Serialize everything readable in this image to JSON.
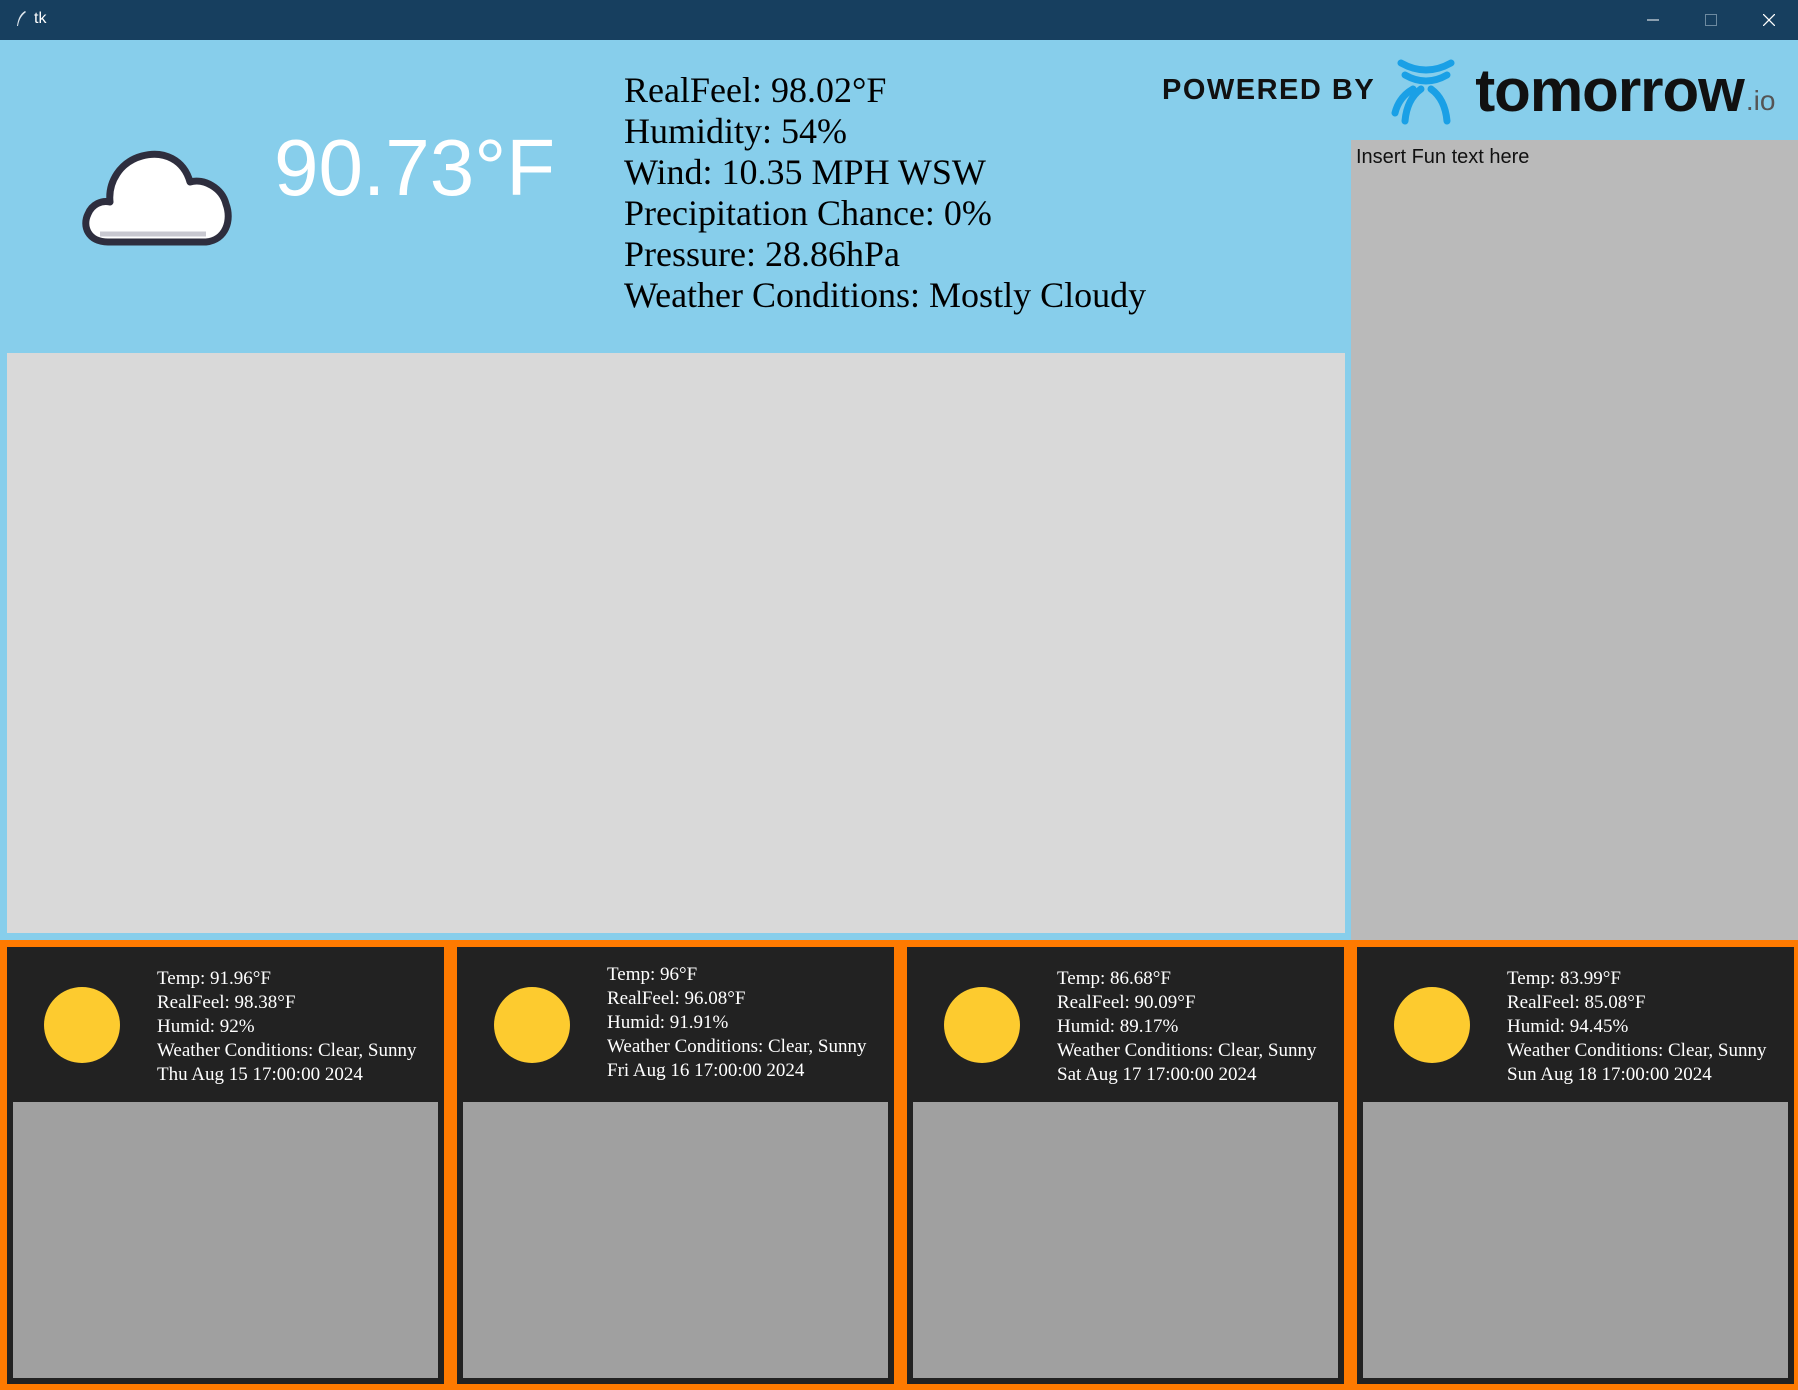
{
  "window": {
    "title": "tk",
    "icons": {
      "app": "feather-icon",
      "minimize": "minimize-icon",
      "maximize": "maximize-icon",
      "close": "close-icon"
    }
  },
  "current": {
    "temperature": "90.73°F",
    "icon": "cloud-icon",
    "details": [
      "RealFeel: 98.02°F",
      "Humidity: 54%",
      "Wind: 10.35 MPH WSW",
      "Precipitation Chance: 0%",
      "Pressure: 28.86hPa",
      "Weather Conditions: Mostly Cloudy"
    ]
  },
  "branding": {
    "powered_by": "POWERED BY",
    "name": "tomorrow",
    "suffix": ".io",
    "logo_icon": "tomorrow-io-logo-icon",
    "logo_color": "#1aa0e6"
  },
  "fun_panel": {
    "text": "Insert Fun text here"
  },
  "forecast": [
    {
      "icon": "sun-icon",
      "lines": [
        "Temp: 91.96°F",
        "RealFeel: 98.38°F",
        "Humid: 92%",
        "Weather Conditions: Clear, Sunny",
        "Thu Aug 15 17:00:00 2024"
      ]
    },
    {
      "icon": "sun-icon",
      "lines": [
        "Temp: 96°F",
        "RealFeel: 96.08°F",
        "Humid: 91.91%",
        "Weather Conditions: Clear, Sunny",
        "Fri Aug 16 17:00:00 2024"
      ]
    },
    {
      "icon": "sun-icon",
      "lines": [
        "Temp: 86.68°F",
        "RealFeel: 90.09°F",
        "Humid: 89.17%",
        "Weather Conditions: Clear, Sunny",
        "Sat Aug 17 17:00:00 2024"
      ]
    },
    {
      "icon": "sun-icon",
      "lines": [
        "Temp: 83.99°F",
        "RealFeel: 85.08°F",
        "Humid: 94.45%",
        "Weather Conditions: Clear, Sunny",
        "Sun Aug 18 17:00:00 2024"
      ]
    }
  ],
  "colors": {
    "background": "#87ceeb",
    "titlebar": "#173f5f",
    "accent_border": "#ff7a00",
    "card_bg": "#222222",
    "sun": "#fdcb2f"
  }
}
